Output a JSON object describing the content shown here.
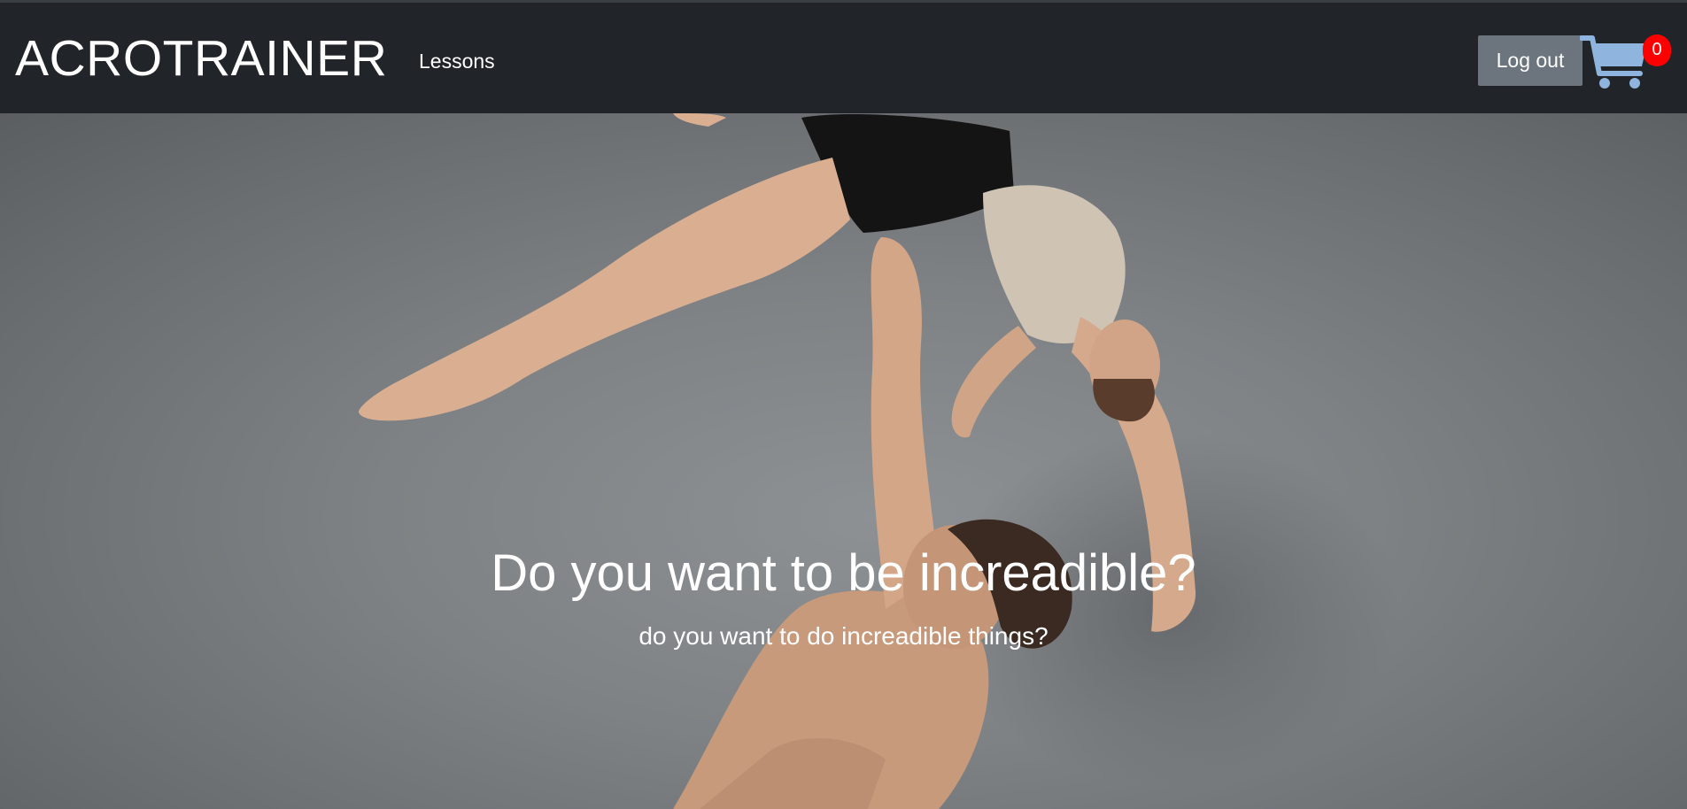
{
  "navbar": {
    "brand": "ACROTRAINER",
    "links": [
      {
        "label": "Lessons"
      }
    ],
    "logout_label": "Log out",
    "cart": {
      "icon": "shopping-cart-icon",
      "count": "0",
      "icon_color": "#8fb4de",
      "badge_color": "#ff0000"
    },
    "background_color": "#212529"
  },
  "hero": {
    "title": "Do you want to be increadible?",
    "subtitle": "do you want to do increadible things?",
    "image": "acrobatic-duo-photo"
  }
}
